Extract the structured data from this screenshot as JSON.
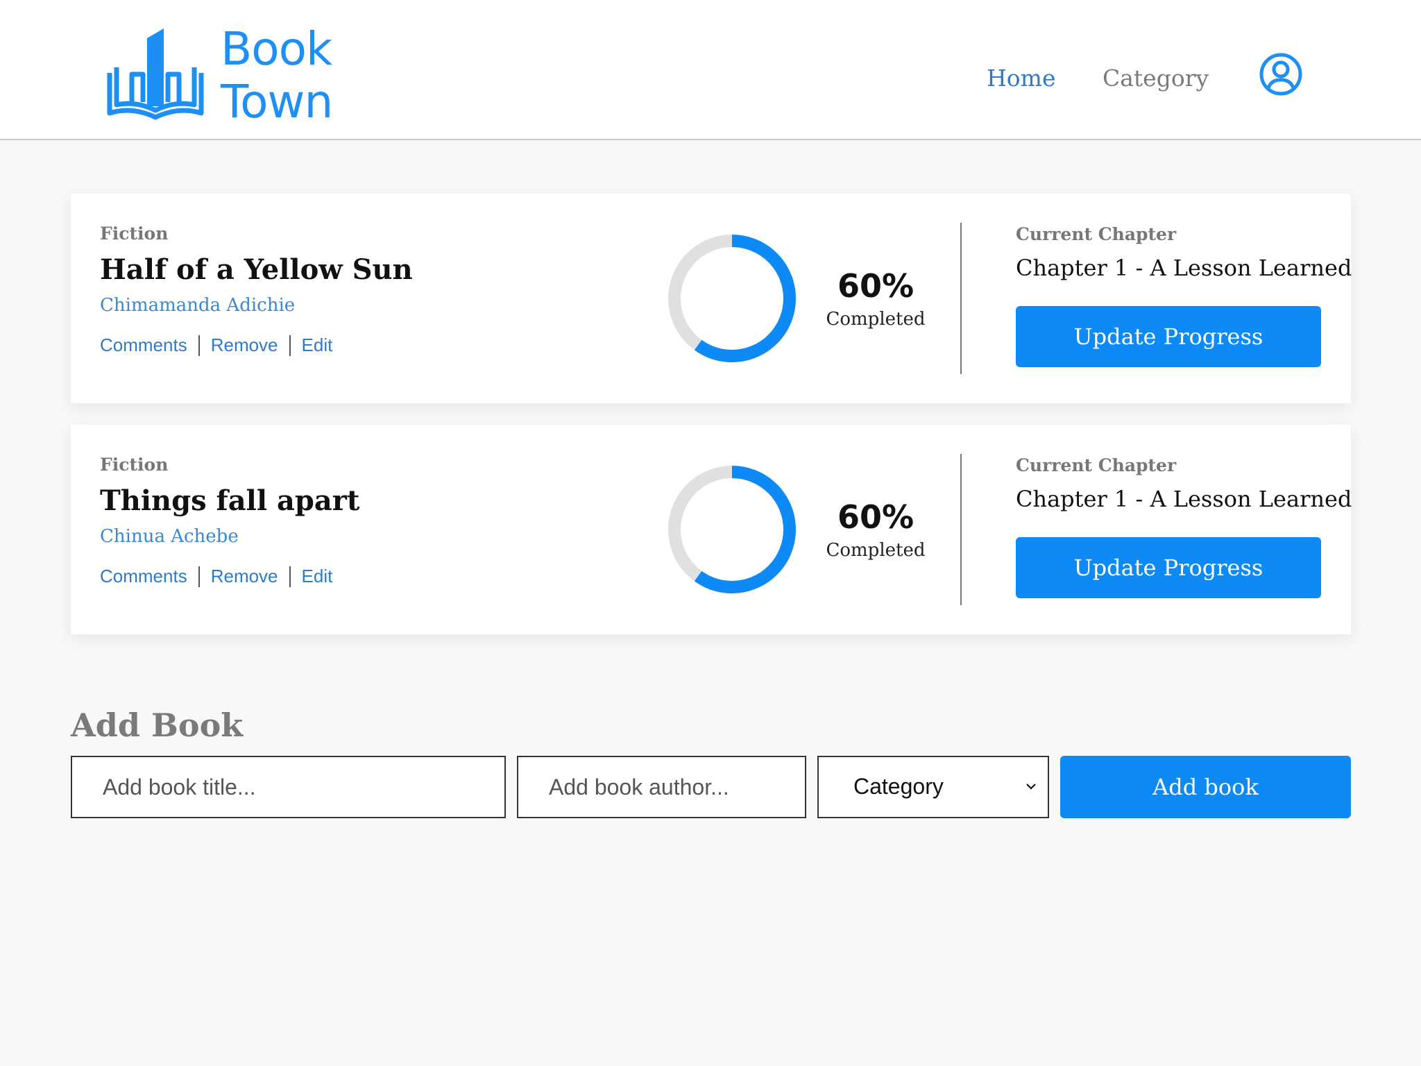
{
  "brand": {
    "line1": "Book",
    "line2": "Town",
    "color": "#1e8ff5"
  },
  "nav": {
    "home": "Home",
    "category": "Category",
    "user_icon": "user-circle-icon"
  },
  "books": [
    {
      "genre": "Fiction",
      "title": "Half of a Yellow Sun",
      "author": "Chimamanda Adichie",
      "actions": [
        "Comments",
        "Remove",
        "Edit"
      ],
      "progress_percent": 60,
      "progress_text": "60%",
      "progress_label": "Completed",
      "chapter_label": "Current Chapter",
      "chapter": "Chapter 1 - A Lesson Learned",
      "button": "Update Progress"
    },
    {
      "genre": "Fiction",
      "title": "Things fall apart",
      "author": "Chinua Achebe",
      "actions": [
        "Comments",
        "Remove",
        "Edit"
      ],
      "progress_percent": 60,
      "progress_text": "60%",
      "progress_label": "Completed",
      "chapter_label": "Current Chapter",
      "chapter": "Chapter 1 - A Lesson Learned",
      "button": "Update Progress"
    }
  ],
  "add_book": {
    "heading": "Add Book",
    "title_placeholder": "Add book title...",
    "author_placeholder": "Add book author...",
    "category_value": "Category",
    "button": "Add book"
  },
  "colors": {
    "accent": "#0d8af5",
    "link": "#2d7bc8",
    "ring_track": "#e0e0e0"
  }
}
